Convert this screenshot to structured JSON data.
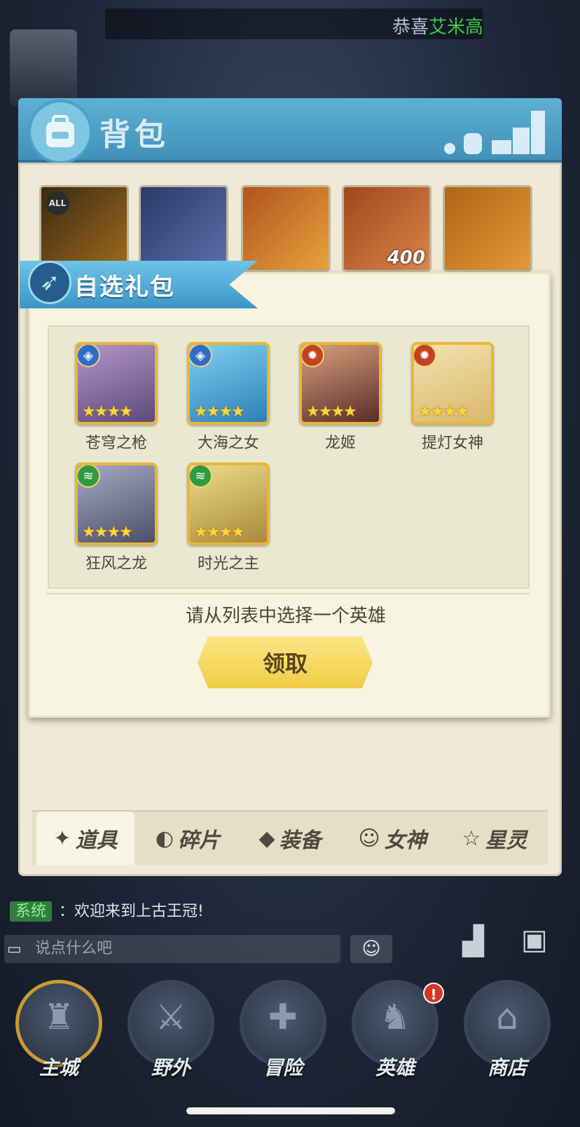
{
  "marquee": {
    "prefix": "恭喜",
    "highlight": "艾米高"
  },
  "bag": {
    "title": "背包",
    "items": [
      {
        "name": "all-item",
        "badge": "ALL",
        "colorA": "#3a2a12",
        "colorB": "#a06a1c",
        "quantity": ""
      },
      {
        "name": "rune-item",
        "badge": "",
        "colorA": "#2a3a6a",
        "colorB": "#5b6fa8",
        "quantity": ""
      },
      {
        "name": "chest-item",
        "badge": "",
        "colorA": "#b0541e",
        "colorB": "#e8a23c",
        "quantity": ""
      },
      {
        "name": "crystal-item",
        "badge": "",
        "colorA": "#a0471b",
        "colorB": "#d9854a",
        "quantity": "400"
      },
      {
        "name": "card-item",
        "badge": "",
        "colorA": "#b06516",
        "colorB": "#e39a38",
        "quantity": ""
      }
    ],
    "tabs": [
      {
        "label": "道具",
        "icon": "✦",
        "active": true
      },
      {
        "label": "碎片",
        "icon": "◐",
        "active": false
      },
      {
        "label": "装备",
        "icon": "◆",
        "active": false
      },
      {
        "label": "女神",
        "icon": "☺",
        "active": false
      },
      {
        "label": "星灵",
        "icon": "☆",
        "active": false
      }
    ]
  },
  "dialog": {
    "title": "自选礼包",
    "heroes": [
      {
        "name": "苍穹之枪",
        "element": "water",
        "colorA": "#5b4a7a",
        "colorB": "#b496c8"
      },
      {
        "name": "大海之女",
        "element": "water",
        "colorA": "#2d7fb8",
        "colorB": "#7fd0ee"
      },
      {
        "name": "龙姬",
        "element": "fire",
        "colorA": "#5a2c2a",
        "colorB": "#d8a07c"
      },
      {
        "name": "提灯女神",
        "element": "fire",
        "colorA": "#d9b86a",
        "colorB": "#f4e2b0"
      },
      {
        "name": "狂风之龙",
        "element": "wind",
        "colorA": "#4a4f6a",
        "colorB": "#a6a9c4"
      },
      {
        "name": "时光之主",
        "element": "wind",
        "colorA": "#a88a3c",
        "colorB": "#efd98a"
      }
    ],
    "stars_text": "★★★★",
    "prompt": "请从列表中选择一个英雄",
    "claim_label": "领取"
  },
  "chat": {
    "tag": "系统",
    "message": "：欢迎来到上古王冠!",
    "input_placeholder": "说点什么吧"
  },
  "nav": [
    {
      "label": "主城",
      "active": true
    },
    {
      "label": "野外",
      "active": false
    },
    {
      "label": "冒险",
      "active": false
    },
    {
      "label": "英雄",
      "active": false
    },
    {
      "label": "商店",
      "active": false
    }
  ],
  "notification": "!"
}
